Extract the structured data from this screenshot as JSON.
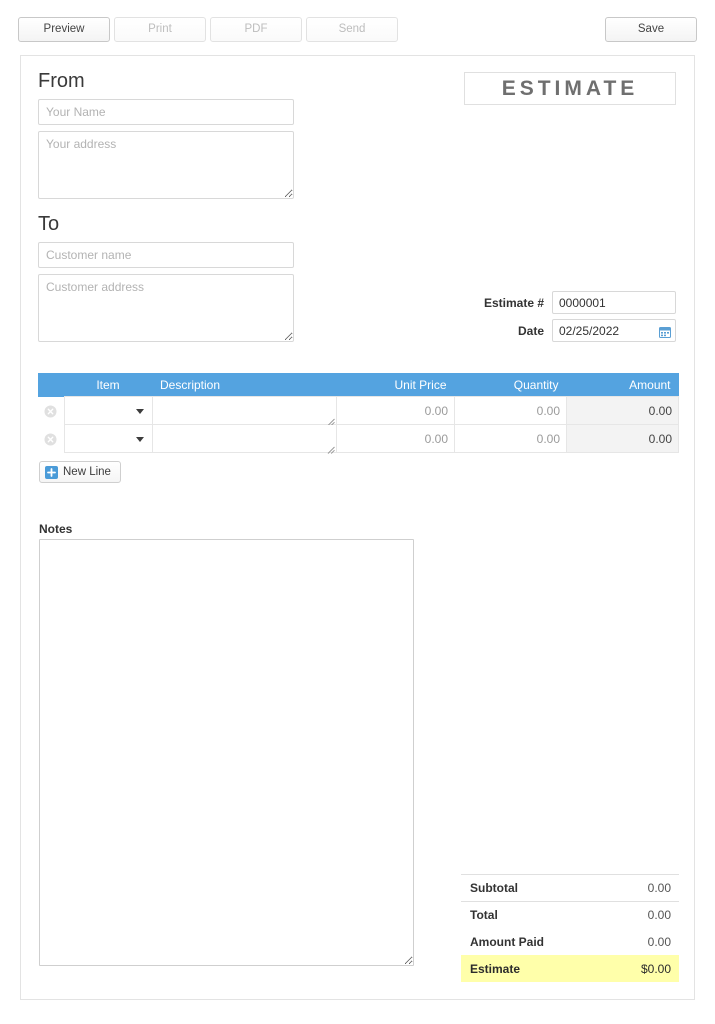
{
  "toolbar": {
    "buttons": [
      {
        "label": "Preview",
        "state": "enabled",
        "name": "preview-button"
      },
      {
        "label": "Print",
        "state": "disabled",
        "name": "print-button"
      },
      {
        "label": "PDF",
        "state": "disabled",
        "name": "pdf-button"
      },
      {
        "label": "Send",
        "state": "disabled",
        "name": "send-button"
      }
    ],
    "save_label": "Save"
  },
  "document": {
    "title": "ESTIMATE"
  },
  "from": {
    "heading": "From",
    "name_value": "",
    "name_placeholder": "Your Name",
    "address_value": "",
    "address_placeholder": "Your address"
  },
  "to": {
    "heading": "To",
    "name_value": "",
    "name_placeholder": "Customer name",
    "address_value": "",
    "address_placeholder": "Customer address"
  },
  "meta": {
    "number_label": "Estimate #",
    "number_value": "0000001",
    "date_label": "Date",
    "date_value": "02/25/2022",
    "calendar_icon": "calendar-icon",
    "calendar_color": "#5a9fd4"
  },
  "items_table": {
    "header_bg": "#54a3e0",
    "columns": [
      "Item",
      "Description",
      "Unit Price",
      "Quantity",
      "Amount"
    ],
    "rows": [
      {
        "delete_icon": "delete-circle-icon",
        "item": "",
        "description": "",
        "unit_price": "0.00",
        "quantity": "0.00",
        "amount": "0.00"
      },
      {
        "delete_icon": "delete-circle-icon",
        "item": "",
        "description": "",
        "unit_price": "0.00",
        "quantity": "0.00",
        "amount": "0.00"
      }
    ]
  },
  "new_line": {
    "label": "New Line",
    "icon": "plus-square-icon",
    "icon_color": "#4a9bd8"
  },
  "notes": {
    "label": "Notes",
    "value": "",
    "placeholder": ""
  },
  "totals": {
    "rows": [
      {
        "label": "Subtotal",
        "value": "0.00",
        "highlight": false
      },
      {
        "label": "Total",
        "value": "0.00",
        "highlight": false
      },
      {
        "label": "Amount Paid",
        "value": "0.00",
        "highlight": false
      },
      {
        "label": "Estimate",
        "value": "$0.00",
        "highlight": true
      }
    ],
    "highlight_color": "#ffffaa"
  }
}
